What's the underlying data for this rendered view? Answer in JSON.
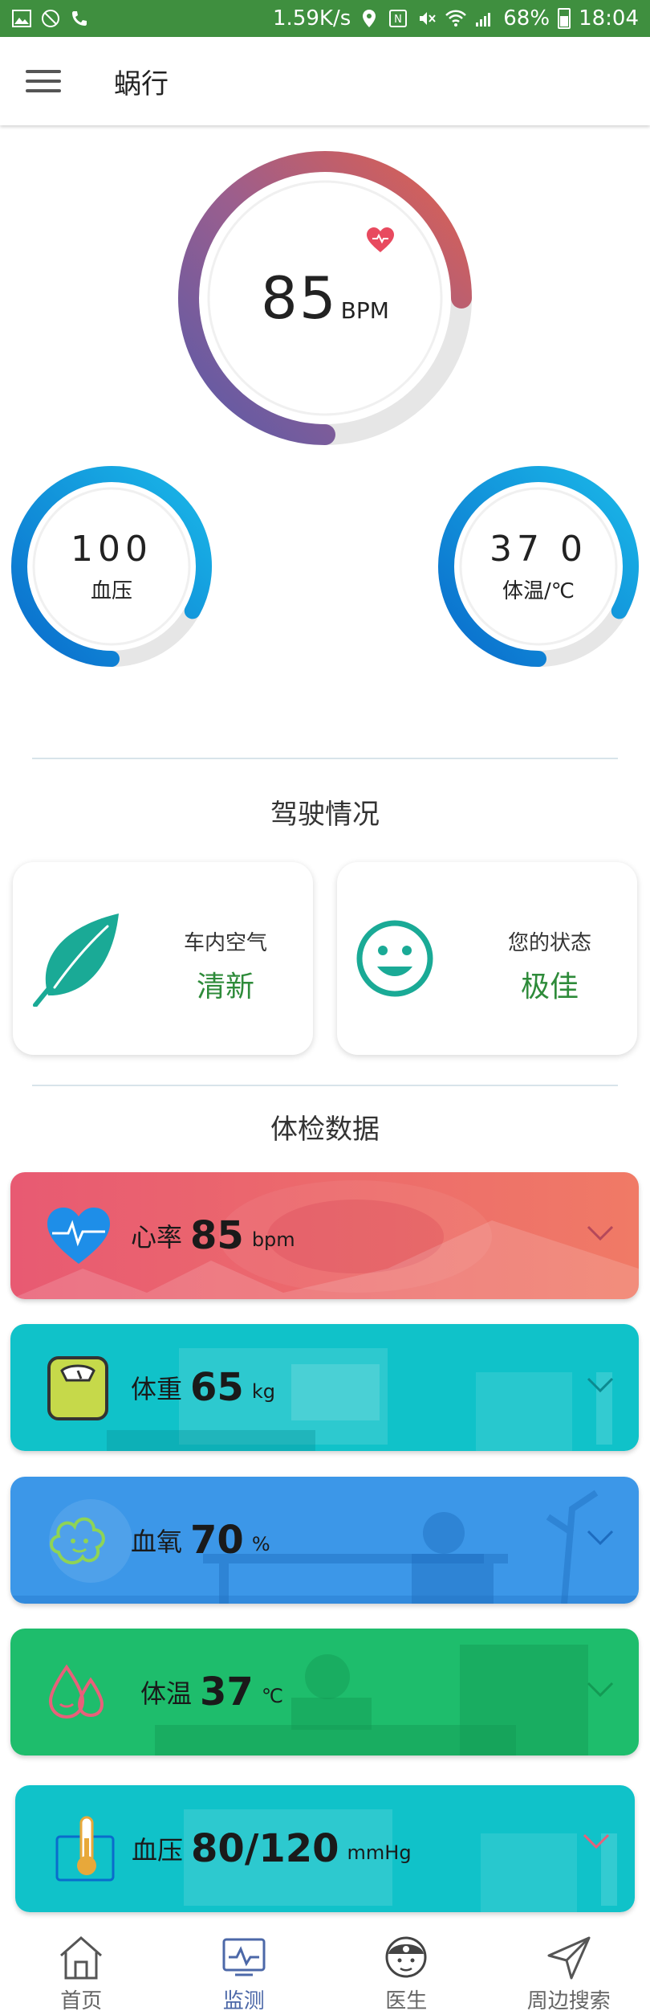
{
  "status_bar": {
    "speed": "1.59K/s",
    "battery": "68%",
    "time": "18:04"
  },
  "app_bar": {
    "title": "蜗行",
    "menu_icon": "hamburger-menu-icon"
  },
  "heart_rate_gauge": {
    "value": "85",
    "unit": "BPM",
    "fill_fraction": 0.75,
    "badge_icon": "heart-pulse-icon"
  },
  "blood_pressure_gauge": {
    "value": "100",
    "label": "血压",
    "fill_fraction": 0.83
  },
  "temperature_gauge": {
    "value": "37 0",
    "label": "体温/℃",
    "fill_fraction": 0.83
  },
  "driving": {
    "title": "驾驶情况",
    "cards": [
      {
        "label": "车内空气",
        "value": "清新",
        "icon": "leaf-icon"
      },
      {
        "label": "您的状态",
        "value": "极佳",
        "icon": "smiley-face-icon"
      }
    ]
  },
  "health": {
    "title": "体检数据",
    "items": [
      {
        "name": "心率",
        "value": "85",
        "unit": "bpm",
        "icon": "heart-icon",
        "color": "#e8606e"
      },
      {
        "name": "体重",
        "value": "65",
        "unit": "kg",
        "icon": "scale-icon",
        "color": "#10c2c9"
      },
      {
        "name": "血氧",
        "value": "70",
        "unit": "%",
        "icon": "oxygen-bubble-icon",
        "color": "#3c97e8"
      },
      {
        "name": "体温",
        "value": "37",
        "unit": "℃",
        "icon": "temperature-drops-icon",
        "color": "#1ebd6c"
      },
      {
        "name": "血压",
        "value": "80/120",
        "unit": "mmHg",
        "icon": "thermometer-icon",
        "color": "#10c2c9"
      }
    ]
  },
  "bottom_nav": {
    "items": [
      {
        "label": "首页",
        "icon": "home-icon",
        "active": false
      },
      {
        "label": "监测",
        "icon": "monitor-icon",
        "active": true
      },
      {
        "label": "医生",
        "icon": "doctor-icon",
        "active": false
      },
      {
        "label": "周边搜索",
        "icon": "navigation-arrow-icon",
        "active": false
      }
    ]
  },
  "colors": {
    "status_bar": "#3f8f3f",
    "accent_green": "#2e8b3a",
    "nav_active": "#4c68a8",
    "gauge_main_start": "#e0604e",
    "gauge_main_end": "#5a5aa8",
    "gauge_small_start": "#1ab8e8",
    "gauge_small_end": "#0a6ccc",
    "teal_icon": "#1aaa96"
  }
}
